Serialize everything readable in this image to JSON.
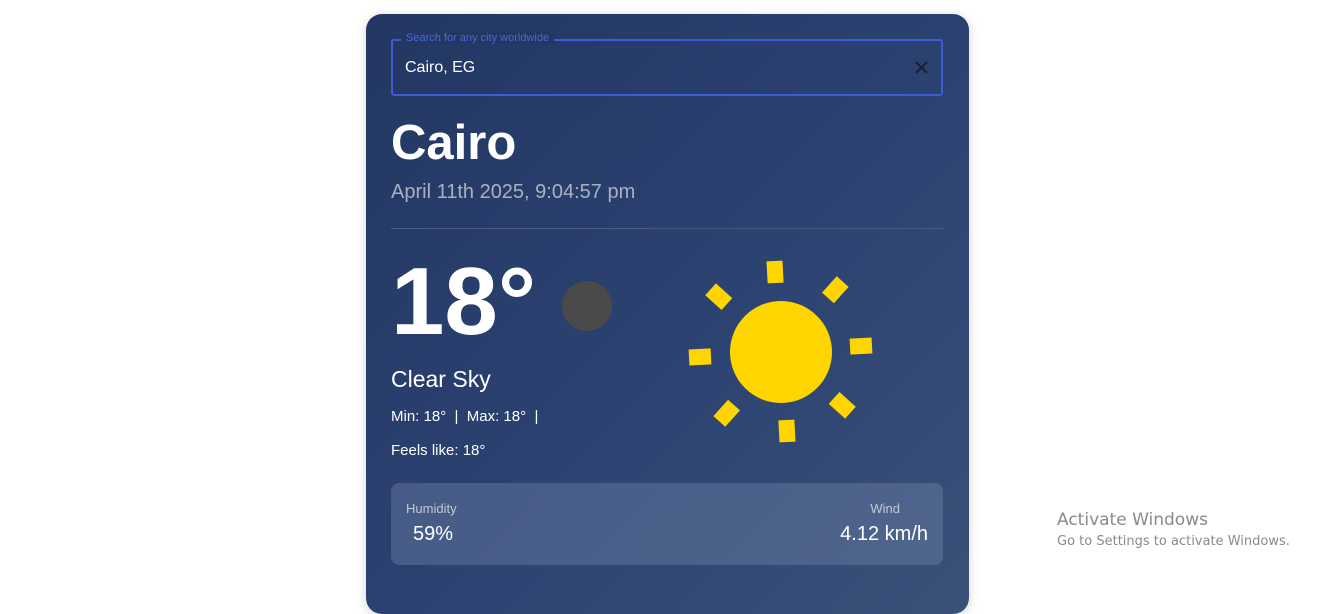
{
  "search": {
    "label": "Search for any city worldwide",
    "value": "Cairo, EG",
    "clear_icon": "close-icon"
  },
  "location": {
    "city": "Cairo",
    "datetime": "April 11th 2025, 9:04:57 pm"
  },
  "weather": {
    "temperature": "18°",
    "condition": "Clear Sky",
    "minmax": "Min: 18°  |  Max: 18°  |",
    "feels_like": "Feels like: 18°",
    "icon": "sun-icon",
    "night_indicator_icon": "moon-icon"
  },
  "stats": {
    "humidity_label": "Humidity",
    "humidity_value": "59%",
    "wind_label": "Wind",
    "wind_value": "4.12 km/h"
  },
  "watermark": {
    "title": "Activate Windows",
    "subtitle": "Go to Settings to activate Windows."
  },
  "colors": {
    "card_bg": "#233762",
    "accent": "#3f5bd6",
    "sun": "#FFD500",
    "moon": "#4a4a4a"
  }
}
